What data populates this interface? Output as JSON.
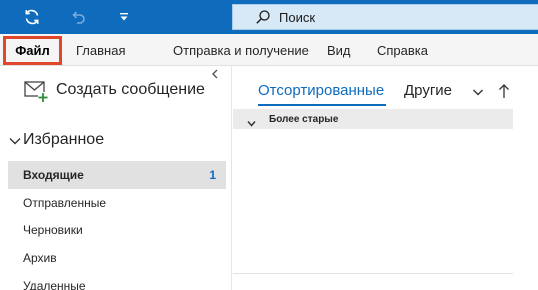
{
  "titlebar": {
    "icons": [
      "sync-icon",
      "undo-icon",
      "customize-toolbar-icon"
    ],
    "search": {
      "placeholder": "Поиск",
      "icon": "search-icon"
    }
  },
  "ribbon": {
    "tabs": [
      {
        "label": "Файл",
        "highlighted": true,
        "highlight_color": "#e0462c"
      },
      {
        "label": "Главная"
      },
      {
        "label": "Отправка и получение"
      },
      {
        "label": "Вид"
      },
      {
        "label": "Справка"
      }
    ]
  },
  "nav": {
    "collapse_icon": "chevron-left-icon",
    "compose": {
      "label": "Создать сообщение",
      "icon": "new-mail-icon"
    },
    "favorites": {
      "label": "Избранное",
      "icon": "chevron-down-icon",
      "folders": [
        {
          "label": "Входящие",
          "count": "1",
          "selected": true
        },
        {
          "label": "Отправленные"
        },
        {
          "label": "Черновики"
        },
        {
          "label": "Архив"
        },
        {
          "label": "Удаленные"
        }
      ]
    }
  },
  "list": {
    "tabs": [
      {
        "label": "Отсортированные",
        "active": true
      },
      {
        "label": "Другие"
      }
    ],
    "filter_icon": "chevron-down-icon",
    "sort_icon": "arrow-up-icon",
    "group": {
      "label": "Более старые",
      "icon": "chevron-down-icon"
    }
  },
  "colors": {
    "titlebar": "#0f6cbd",
    "accent": "#0f6cbd",
    "file_tab_outline": "#e0462c"
  }
}
